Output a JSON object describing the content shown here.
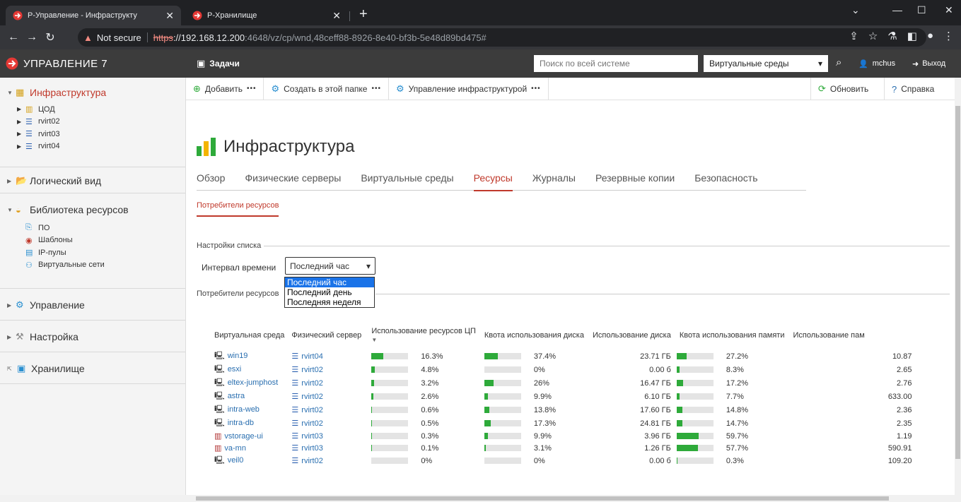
{
  "browser": {
    "tabs": [
      {
        "title": "Р-Управление - Инфраструкту",
        "active": true
      },
      {
        "title": "Р-Хранилище",
        "active": false
      }
    ],
    "address": {
      "warning": "Not secure",
      "protocol": "https",
      "host": "://192.168.12.200",
      "path": ":4648/vz/cp/wnd,48ceff88-8926-8e40-bf3b-5e48d89bd475#"
    }
  },
  "header": {
    "brand": "УПРАВЛЕНИЕ 7",
    "tasks": "Задачи",
    "search_placeholder": "Поиск по всей системе",
    "env_select": "Виртуальные среды",
    "user": "mchus",
    "logout": "Выход"
  },
  "sidebar": {
    "infra": "Инфраструктура",
    "infra_items": [
      "ЦОД",
      "rvirt02",
      "rvirt03",
      "rvirt04"
    ],
    "logical": "Логический вид",
    "library": "Библиотека ресурсов",
    "library_items": [
      "ПО",
      "Шаблоны",
      "IP-пулы",
      "Виртуальные сети"
    ],
    "management": "Управление",
    "settings": "Настройка",
    "storage": "Хранилище"
  },
  "actions": {
    "add": "Добавить",
    "create": "Создать в этой папке",
    "manage": "Управление инфраструктурой",
    "refresh": "Обновить",
    "help": "Справка"
  },
  "page": {
    "title": "Инфраструктура",
    "tabs": [
      "Обзор",
      "Физические серверы",
      "Виртуальные среды",
      "Ресурсы",
      "Журналы",
      "Резервные копии",
      "Безопасность"
    ],
    "active_tab": "Ресурсы",
    "subtab": "Потребители ресурсов",
    "list_settings": "Настройки списка",
    "interval_label": "Интервал времени",
    "interval_value": "Последний час",
    "interval_options": [
      "Последний час",
      "Последний день",
      "Последняя неделя"
    ],
    "consumers_legend": "Потребители ресурсов"
  },
  "table": {
    "headers": [
      "Виртуальная среда",
      "Физический сервер",
      "Использование ресурсов ЦП",
      "Квота использования диска",
      "Использование диска",
      "Квота использования памяти",
      "Использование пам"
    ],
    "rows": [
      {
        "vm": "win19",
        "type": "vm",
        "server": "rvirt04",
        "cpu": 16.3,
        "cpu_label": "16.3%",
        "dq": 37.4,
        "dq_label": "37.4%",
        "disk": "23.71 ГБ",
        "mq": 27.2,
        "mq_label": "27.2%",
        "mem": "10.87"
      },
      {
        "vm": "esxi",
        "type": "vm",
        "server": "rvirt02",
        "cpu": 4.8,
        "cpu_label": "4.8%",
        "dq": 0,
        "dq_label": "0%",
        "disk": "0.00 б",
        "mq": 8.3,
        "mq_label": "8.3%",
        "mem": "2.65"
      },
      {
        "vm": "eltex-jumphost",
        "type": "vm",
        "server": "rvirt02",
        "cpu": 3.2,
        "cpu_label": "3.2%",
        "dq": 26,
        "dq_label": "26%",
        "disk": "16.47 ГБ",
        "mq": 17.2,
        "mq_label": "17.2%",
        "mem": "2.76"
      },
      {
        "vm": "astra",
        "type": "vm",
        "server": "rvirt02",
        "cpu": 2.6,
        "cpu_label": "2.6%",
        "dq": 9.9,
        "dq_label": "9.9%",
        "disk": "6.10 ГБ",
        "mq": 7.7,
        "mq_label": "7.7%",
        "mem": "633.00"
      },
      {
        "vm": "intra-web",
        "type": "vm",
        "server": "rvirt02",
        "cpu": 0.6,
        "cpu_label": "0.6%",
        "dq": 13.8,
        "dq_label": "13.8%",
        "disk": "17.60 ГБ",
        "mq": 14.8,
        "mq_label": "14.8%",
        "mem": "2.36"
      },
      {
        "vm": "intra-db",
        "type": "vm",
        "server": "rvirt02",
        "cpu": 0.5,
        "cpu_label": "0.5%",
        "dq": 17.3,
        "dq_label": "17.3%",
        "disk": "24.81 ГБ",
        "mq": 14.7,
        "mq_label": "14.7%",
        "mem": "2.35"
      },
      {
        "vm": "vstorage-ui",
        "type": "ct",
        "server": "rvirt03",
        "cpu": 0.3,
        "cpu_label": "0.3%",
        "dq": 9.9,
        "dq_label": "9.9%",
        "disk": "3.96 ГБ",
        "mq": 59.7,
        "mq_label": "59.7%",
        "mem": "1.19"
      },
      {
        "vm": "va-mn",
        "type": "ct",
        "server": "rvirt03",
        "cpu": 0.1,
        "cpu_label": "0.1%",
        "dq": 3.1,
        "dq_label": "3.1%",
        "disk": "1.26 ГБ",
        "mq": 57.7,
        "mq_label": "57.7%",
        "mem": "590.91"
      },
      {
        "vm": "veil0",
        "type": "vm",
        "server": "rvirt02",
        "cpu": 0,
        "cpu_label": "0%",
        "dq": 0,
        "dq_label": "0%",
        "disk": "0.00 б",
        "mq": 0.3,
        "mq_label": "0.3%",
        "mem": "109.20"
      }
    ]
  },
  "colors": {
    "accent": "#c0392b",
    "bar_fill": "#2eaa3a",
    "header_bg": "#3c3c3c"
  }
}
